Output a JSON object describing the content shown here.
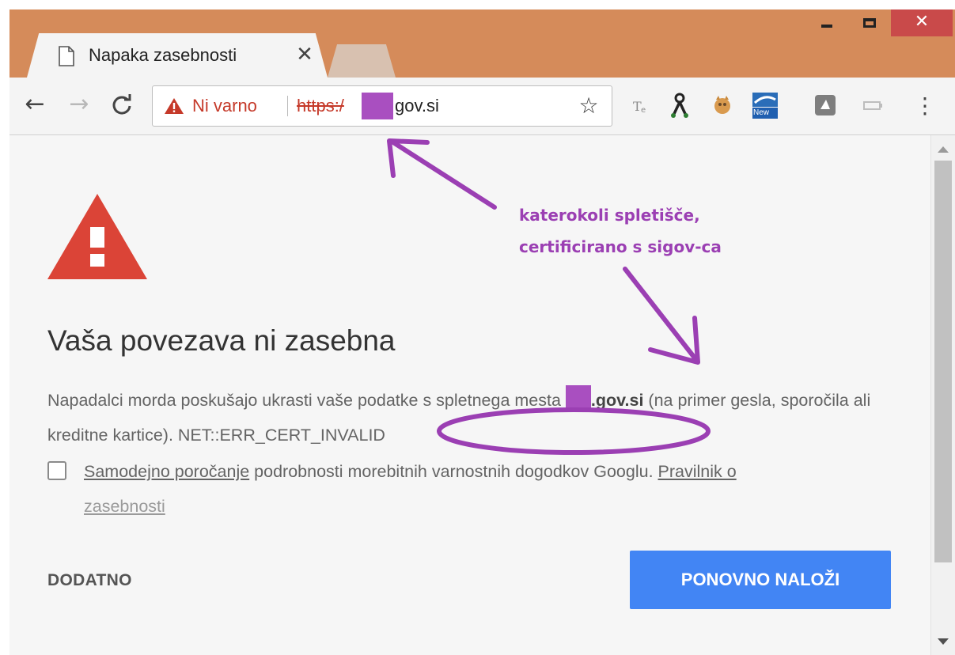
{
  "tab": {
    "title": "Napaka zasebnosti",
    "close_glyph": "✕",
    "icon": "document-icon"
  },
  "window_controls": {
    "close_glyph": "✕"
  },
  "toolbar": {
    "back_glyph": "←",
    "forward_glyph": "→",
    "reload_glyph": "C",
    "bookmark_glyph": "☆",
    "menu_glyph": "⋮"
  },
  "omnibox": {
    "security_label": "Ni varno",
    "url_scheme": "https:/",
    "url_host": "gov.si"
  },
  "extensions": [
    {
      "icon": "tinyeye-icon"
    },
    {
      "icon": "person-figure-icon"
    },
    {
      "icon": "fox-icon"
    },
    {
      "icon": "new-extension-icon",
      "badge": "New"
    },
    {
      "icon": "gray-square-icon"
    },
    {
      "icon": "battery-icon"
    }
  ],
  "interstitial": {
    "heading": "Vaša povezava ni zasebna",
    "para_before": "Napadalci morda poskušajo ukrasti vaše podatke s spletnega mesta ",
    "host_bold": ".gov.si",
    "para_after": " (na primer gesla, sporočila ali kreditne kartice). ",
    "error_code": "NET::ERR_CERT_INVALID",
    "checkbox_link": "Samodejno poročanje",
    "checkbox_text": " podrobnosti morebitnih varnostnih dogodkov Googlu. ",
    "policy_link_1": "Pravilnik o",
    "policy_link_2": "zasebnosti",
    "details_button": "DODATNO",
    "reload_button": "PONOVNO NALOŽI"
  },
  "annotation": {
    "line1": "katerokoli spletišče,",
    "line2": "certificirano s sigov-ca",
    "color": "#9b3fb3"
  },
  "colors": {
    "titlebar": "#d58b5a",
    "danger_red": "#db4437",
    "insecure_text": "#c53929",
    "primary_button": "#4285f4",
    "redaction": "#a94fc0"
  }
}
